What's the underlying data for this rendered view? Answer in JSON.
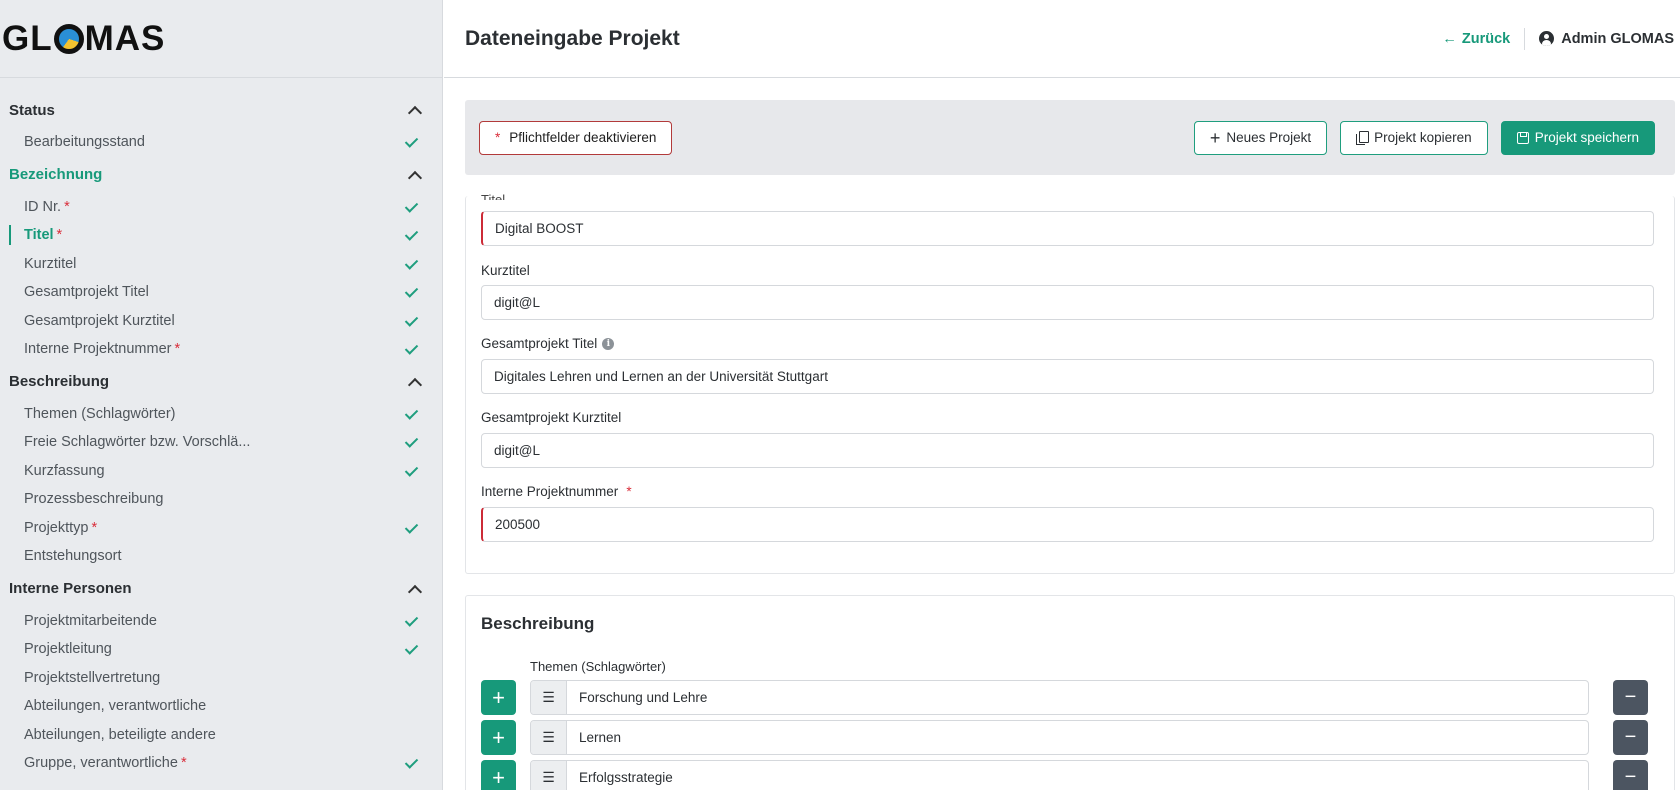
{
  "app": {
    "logo_pre": "GL",
    "logo_post": "MAS"
  },
  "header": {
    "title": "Dateneingabe Projekt",
    "back_label": "Zurück",
    "back_icon": "arrow-left-icon",
    "user_name": "Admin GLOMAS",
    "user_icon": "user-circle-icon"
  },
  "toolbar": {
    "required_toggle_star": "*",
    "required_toggle_label": "Pflichtfelder deaktivieren",
    "new_project_label": "Neues Projekt",
    "copy_project_label": "Projekt kopieren",
    "save_project_label": "Projekt speichern",
    "accent_color": "#17997a"
  },
  "sidebar": {
    "groups": [
      {
        "title": "Status",
        "active": false,
        "items": [
          {
            "label": "Bearbeitungsstand",
            "required": false,
            "done": true
          }
        ]
      },
      {
        "title": "Bezeichnung",
        "active": true,
        "items": [
          {
            "label": "ID Nr.",
            "required": true,
            "done": true
          },
          {
            "label": "Titel",
            "required": true,
            "done": true,
            "active": true
          },
          {
            "label": "Kurztitel",
            "required": false,
            "done": true
          },
          {
            "label": "Gesamtprojekt Titel",
            "required": false,
            "done": true
          },
          {
            "label": "Gesamtprojekt Kurztitel",
            "required": false,
            "done": true
          },
          {
            "label": "Interne Projektnummer",
            "required": true,
            "done": true
          }
        ]
      },
      {
        "title": "Beschreibung",
        "active": false,
        "items": [
          {
            "label": "Themen (Schlagwörter)",
            "required": false,
            "done": true
          },
          {
            "label": "Freie Schlagwörter bzw. Vorschlä...",
            "required": false,
            "done": true
          },
          {
            "label": "Kurzfassung",
            "required": false,
            "done": true
          },
          {
            "label": "Prozessbeschreibung",
            "required": false,
            "done": false
          },
          {
            "label": "Projekttyp",
            "required": true,
            "done": true
          },
          {
            "label": "Entstehungsort",
            "required": false,
            "done": false
          }
        ]
      },
      {
        "title": "Interne Personen",
        "active": false,
        "items": [
          {
            "label": "Projektmitarbeitende",
            "required": false,
            "done": true
          },
          {
            "label": "Projektleitung",
            "required": false,
            "done": true
          },
          {
            "label": "Projektstellvertretung",
            "required": false,
            "done": false
          },
          {
            "label": "Abteilungen, verantwortliche",
            "required": false,
            "done": false
          },
          {
            "label": "Abteilungen, beteiligte andere",
            "required": false,
            "done": false
          },
          {
            "label": "Gruppe, verantwortliche",
            "required": true,
            "done": true
          }
        ]
      }
    ]
  },
  "form": {
    "cut_label": "Titel",
    "titel_value": "Digital BOOST",
    "kurztitel_label": "Kurztitel",
    "kurztitel_value": "digit@L",
    "gesamt_titel_label": "Gesamtprojekt Titel",
    "gesamt_titel_value": "Digitales Lehren und Lernen an der Universität Stuttgart",
    "gesamt_kurztitel_label": "Gesamtprojekt Kurztitel",
    "gesamt_kurztitel_value": "digit@L",
    "projektnummer_label": "Interne Projektnummer",
    "projektnummer_star": "*",
    "projektnummer_value": "200500"
  },
  "beschreibung": {
    "title": "Beschreibung",
    "themen_label": "Themen (Schlagwörter)",
    "themen": [
      "Forschung und Lehre",
      "Lernen",
      "Erfolgsstrategie"
    ]
  }
}
